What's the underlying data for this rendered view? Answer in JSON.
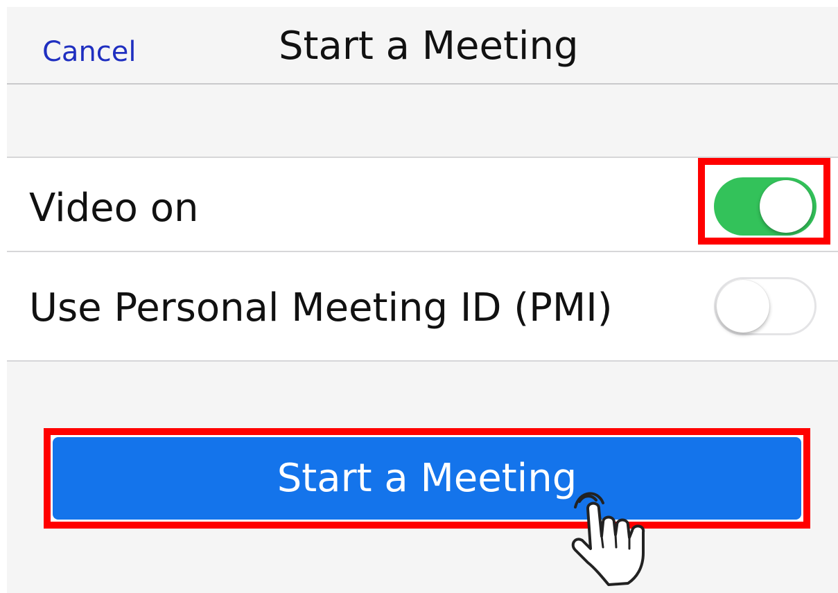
{
  "header": {
    "cancel_label": "Cancel",
    "title": "Start a Meeting"
  },
  "settings": {
    "video_on": {
      "label": "Video on",
      "enabled": true
    },
    "use_pmi": {
      "label": "Use Personal Meeting ID (PMI)",
      "enabled": false
    }
  },
  "actions": {
    "start_button_label": "Start a Meeting"
  },
  "colors": {
    "toggle_on": "#33c25a",
    "button_blue": "#1474eb",
    "highlight_red": "#ff0000",
    "link_blue": "#1f2fc0"
  },
  "icons": {
    "pointer": "hand-pointer-icon"
  }
}
